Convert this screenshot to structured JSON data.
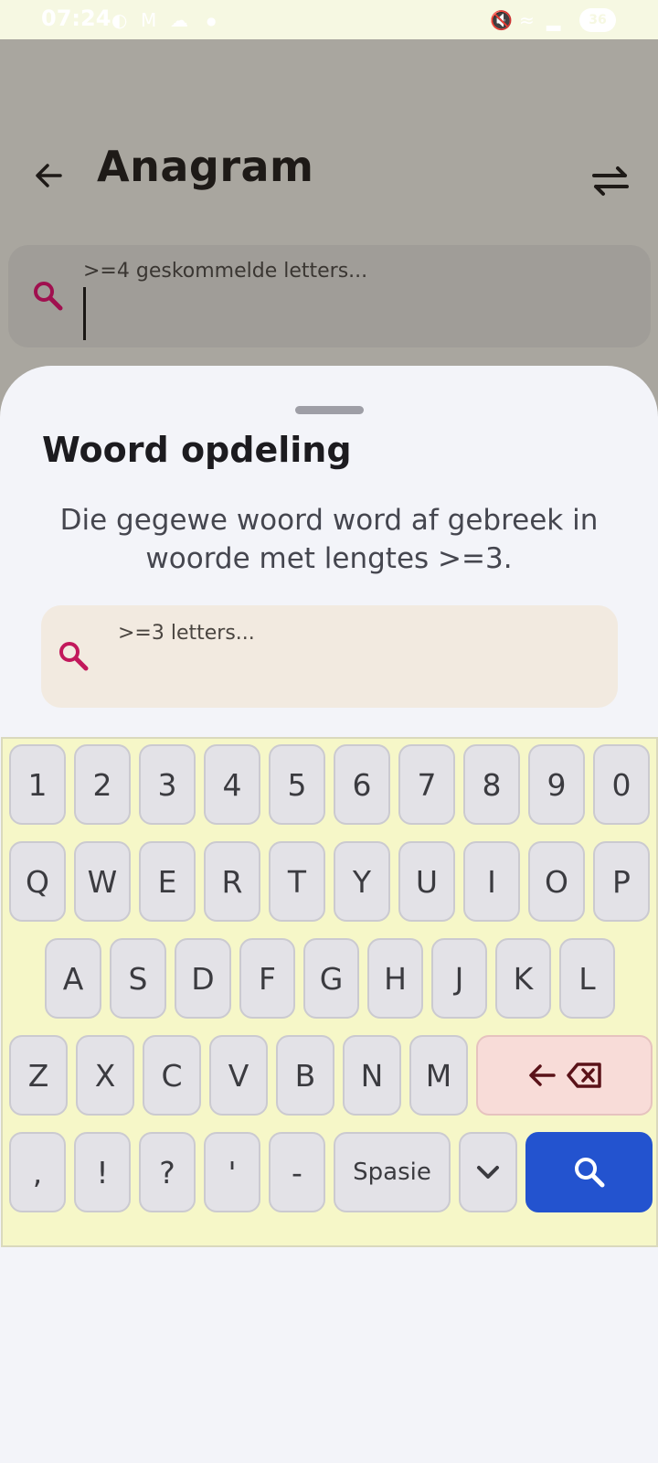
{
  "status_bar": {
    "time": "07:24",
    "battery": "36",
    "left_icons": [
      "hotspot-icon",
      "gmail-icon",
      "cloud-icon",
      "dot-icon"
    ],
    "right_icons": [
      "mute-icon",
      "wifi-icon",
      "signal-icon",
      "battery-icon"
    ]
  },
  "app": {
    "title": "Anagram",
    "search_placeholder": ">=4 geskommelde letters..."
  },
  "sheet": {
    "title": "Woord opdeling",
    "description": "Die gegewe woord word af gebreek in woorde met lengtes >=3.",
    "search_placeholder": ">=3 letters..."
  },
  "keyboard": {
    "row1": [
      "1",
      "2",
      "3",
      "4",
      "5",
      "6",
      "7",
      "8",
      "9",
      "0"
    ],
    "row2": [
      "Q",
      "W",
      "E",
      "R",
      "T",
      "Y",
      "U",
      "I",
      "O",
      "P"
    ],
    "row3": [
      "A",
      "S",
      "D",
      "F",
      "G",
      "H",
      "J",
      "K",
      "L"
    ],
    "row4": [
      "Z",
      "X",
      "C",
      "V",
      "B",
      "N",
      "M"
    ],
    "row5": [
      ",",
      "!",
      "?",
      "'",
      "-"
    ],
    "space_label": "Spasie"
  },
  "colors": {
    "accent_magenta": "#c2185b",
    "go_button": "#2353cf",
    "keyboard_bg": "#f6f7c8",
    "backspace_bg": "#f8dcd8"
  }
}
